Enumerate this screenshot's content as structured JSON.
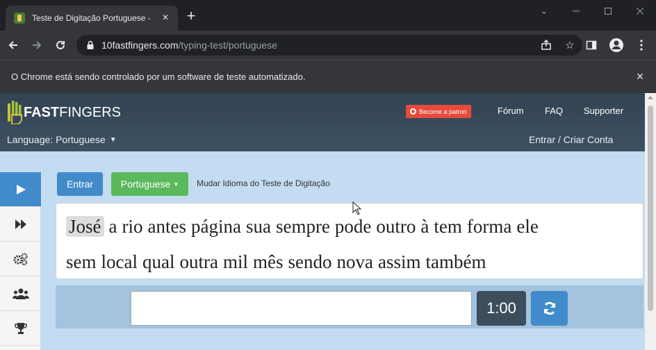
{
  "browser": {
    "tab_title": "Teste de Digitação Portuguese -",
    "url_host": "10fastfingers.com",
    "url_path": "/typing-test/portuguese",
    "infobar_text": "O Chrome está sendo controlado por um software de teste automatizado."
  },
  "header": {
    "logo_a": "10",
    "logo_b": "FAST",
    "logo_c": "FINGERS",
    "patron_label": "Become a patron",
    "nav": [
      "Fórum",
      "FAQ",
      "Supporter"
    ],
    "language_label": "Language: Portuguese",
    "login_label": "Entrar / Criar Conta"
  },
  "sidebar": {
    "items": [
      "play-icon",
      "fast-forward-icon",
      "gears-icon",
      "users-icon",
      "trophy-icon"
    ]
  },
  "content": {
    "entrar_label": "Entrar",
    "language_button": "Portuguese",
    "change_language": "Mudar Idioma do Teste de Digitação",
    "words_line1": [
      "José",
      "a",
      "rio",
      "antes",
      "página",
      "sua",
      "sempre",
      "pode",
      "outro",
      "à",
      "tem",
      "forma",
      "ele"
    ],
    "words_line2": [
      "sem",
      "local",
      "qual",
      "outra",
      "mil",
      "mês",
      "sendo",
      "nova",
      "assim",
      "também"
    ],
    "input_value": "",
    "timer": "1:00"
  },
  "colors": {
    "accent_blue": "#428bca",
    "green": "#5cb85c",
    "patron_red": "#e64a3c",
    "header_dark": "#324352",
    "page_bg": "#c3dcf2"
  }
}
